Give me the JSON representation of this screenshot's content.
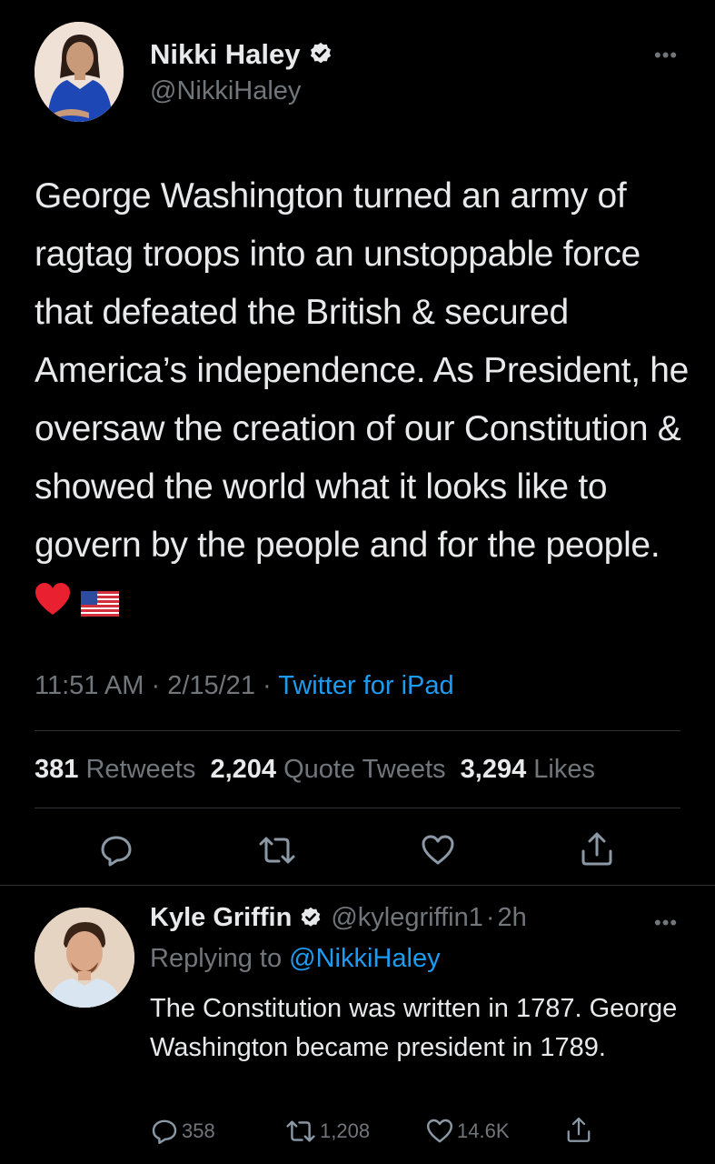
{
  "main_tweet": {
    "display_name": "Nikki Haley",
    "handle": "@NikkiHaley",
    "text": "George Washington turned an army of ragtag troops into an unstoppable force that defeated the British & secured America’s independence. As President, he oversaw the creation of our Constitution & showed the world what it looks like to govern by the people and for the people.",
    "emojis": [
      "red-heart-emoji",
      "us-flag-emoji"
    ],
    "time": "11:51 AM",
    "date": "2/15/21",
    "source": "Twitter for iPad",
    "separator": "·",
    "stats": {
      "retweets_count": "381",
      "retweets_label": "Retweets",
      "quotes_count": "2,204",
      "quotes_label": "Quote Tweets",
      "likes_count": "3,294",
      "likes_label": "Likes"
    },
    "actions": [
      "reply-icon",
      "retweet-icon",
      "like-icon",
      "share-icon"
    ]
  },
  "reply": {
    "display_name": "Kyle Griffin",
    "handle": "@kylegriffin1",
    "age": "2h",
    "separator": "·",
    "replying_label": "Replying to",
    "replying_to": "@NikkiHaley",
    "text": "The Constitution was written in 1787. George Washington became president in 1789.",
    "reply_count": "358",
    "retweet_count": "1,208",
    "like_count": "14.6K"
  },
  "colors": {
    "background": "#000000",
    "text": "#e7e9ea",
    "secondary": "#71767b",
    "link": "#1d9bf0",
    "divider": "#2f3336"
  }
}
